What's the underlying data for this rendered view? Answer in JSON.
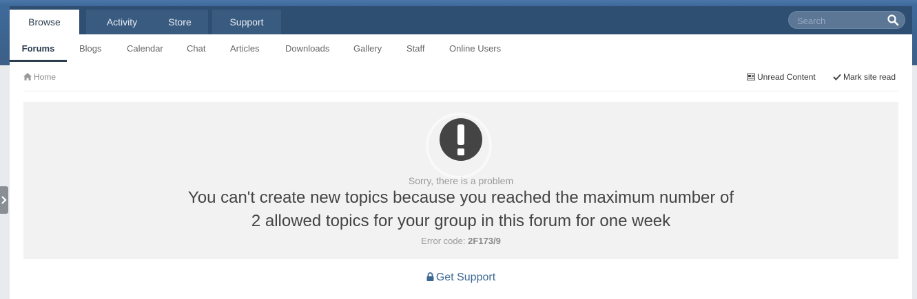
{
  "header": {
    "tabs": [
      {
        "label": "Browse",
        "active": true
      },
      {
        "label": "Activity",
        "active": false
      },
      {
        "label": "Store",
        "active": false
      },
      {
        "label": "Support",
        "active": false
      }
    ],
    "search": {
      "placeholder": "Search",
      "icon": "search-icon"
    }
  },
  "subnav": {
    "items": [
      {
        "label": "Forums",
        "active": true
      },
      {
        "label": "Blogs"
      },
      {
        "label": "Calendar"
      },
      {
        "label": "Chat"
      },
      {
        "label": "Articles"
      },
      {
        "label": "Downloads"
      },
      {
        "label": "Gallery"
      },
      {
        "label": "Staff"
      },
      {
        "label": "Online Users"
      }
    ]
  },
  "breadcrumb": {
    "home": "Home",
    "home_icon": "home-icon",
    "unread_content": "Unread Content",
    "mark_site_read": "Mark site read"
  },
  "error": {
    "icon": "exclamation-icon",
    "sorry": "Sorry, there is a problem",
    "message_line1": "You can't create new topics because you reached the maximum number of",
    "message_line2": "2 allowed topics for your group in this forum for one week",
    "code_label": "Error code:",
    "code": "2F173/9"
  },
  "support": {
    "label": "Get Support",
    "icon": "lock-icon"
  },
  "colors": {
    "header": "#2f4f72",
    "accent": "#3c6894",
    "panel": "#f2f2f2"
  }
}
